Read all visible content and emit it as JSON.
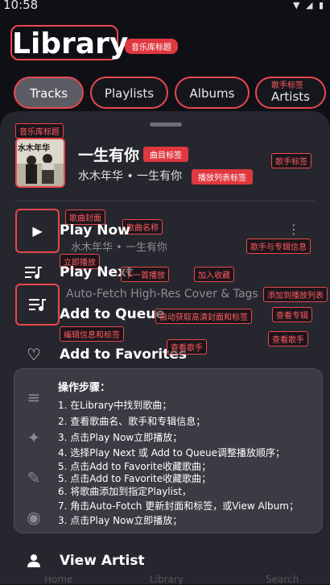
{
  "status": {
    "time": "10:58"
  },
  "header": {
    "title": "Library",
    "title_tag": "音乐库标题"
  },
  "tabs": [
    "Tracks",
    "Playlists",
    "Albums",
    "Artists"
  ],
  "tab_tag": "歌手标签",
  "sheet": {
    "side_tag": "音乐库标题",
    "song": {
      "title": "一生有你",
      "artist": "水木年华",
      "separator": "•",
      "album": "一生有你",
      "cover_text": "水木年华"
    },
    "annotations": {
      "song_title": "曲目标签",
      "playlist": "播放列表标签",
      "singer": "歌手标签",
      "cover": "歌曲封面",
      "song_name": "歌曲名称",
      "play_now": "立即播放",
      "artist_album": "歌手与专辑信息",
      "play_next": "下一首播放",
      "favorite": "加入收藏",
      "add_queue_tag": "添加到播放列表",
      "auto_fetch": "自动获取高清封面和标签",
      "view_album": "查看专辑",
      "edit_info": "编辑信息和标签",
      "view_artist_a": "查看歌手",
      "view_artist_b": "查看歌手"
    },
    "menu": {
      "play_now": "Play Now",
      "play_now_sub": "水木年华 • 一生有你",
      "play_next": "Play Next",
      "auto_fetch": "Auto-Fetch High-Res Cover & Tags",
      "add_queue": "Add to Queue",
      "add_favorites": "Add to Favorites",
      "view_artist": "View Artist"
    }
  },
  "panel": {
    "title": "操作步骤：",
    "steps": [
      "1. 在Library中找到歌曲；",
      "2. 查看歌曲名、歌手和专辑信息；",
      "3. 点击Play Now立即播放；",
      "4. 选择Play Next 或 Add to Queue调整播放顺序；",
      "5. 点击Add to Favorite收藏歌曲；",
      "5. 点击Add to Favorite收藏歌曲；",
      "6. 将歌曲添加到指定Playlist，",
      "7. 角击Auto-Fotch 更新封面和标签，或View Album；",
      "3. 点击Play Now立即播放；"
    ]
  },
  "bottom_nav": [
    "Home",
    "Library",
    "Search"
  ]
}
